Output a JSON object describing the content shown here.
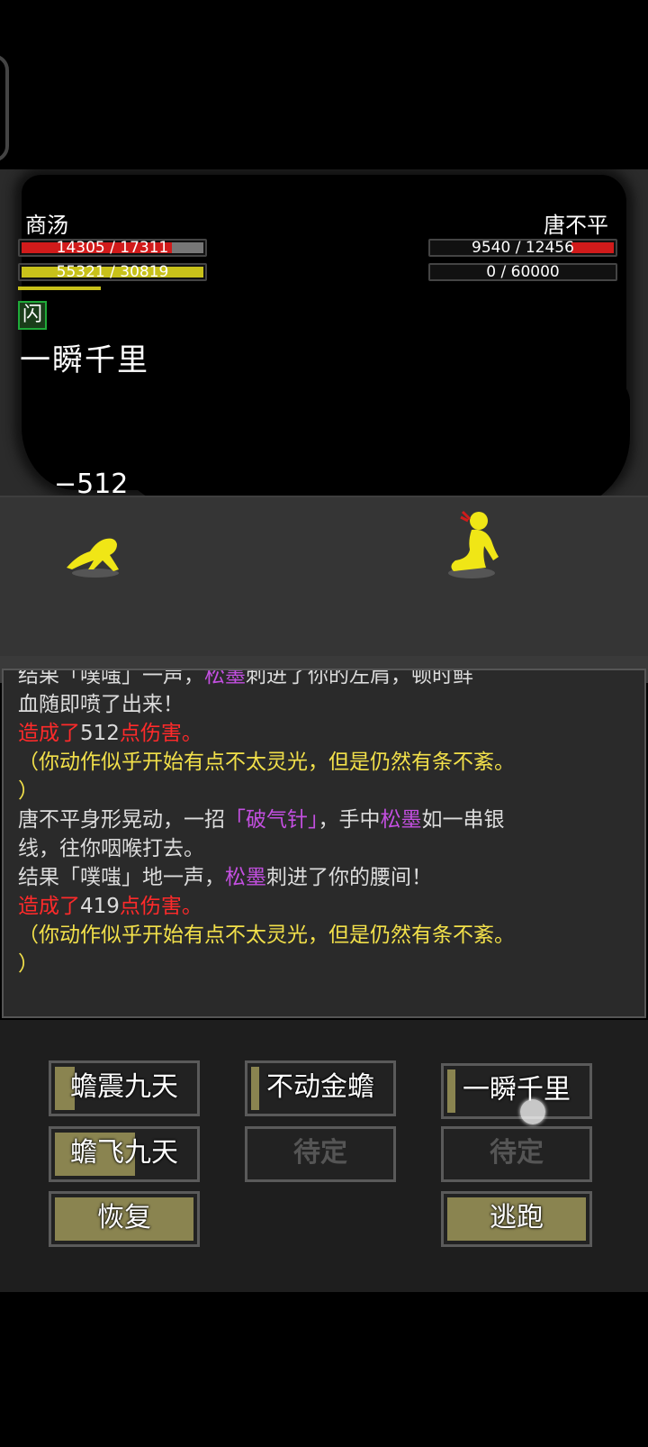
{
  "player": {
    "name": "商汤",
    "hp_text": "14305 / 17311",
    "hp_fraction": 0.826,
    "mp_text": "55321 / 30819",
    "mp_fraction": 1.0,
    "status_badge": "闪",
    "colors": {
      "hp": "#d01b1b",
      "mp": "#c8c11a"
    }
  },
  "enemy": {
    "name": "唐不平",
    "hp_text": "9540 / 12456",
    "hp_fraction": 0.766,
    "mp_text": "0 / 60000",
    "mp_fraction": 0.0
  },
  "battle": {
    "current_skill": "一瞬千里",
    "damage_popup": "−512",
    "figure_color": "#f0e616"
  },
  "log": {
    "lines": [
      {
        "segments": [
          {
            "text": "结果「噗嗤」一声，",
            "c": "l-white"
          },
          {
            "text": "松墨",
            "c": "l-purple"
          },
          {
            "text": "刺进了你的左肩，顿时鲜",
            "c": "l-white"
          }
        ]
      },
      {
        "segments": [
          {
            "text": "血随即喷了出来！",
            "c": "l-white"
          }
        ]
      },
      {
        "segments": [
          {
            "text": "造成了",
            "c": "l-red"
          },
          {
            "text": "512",
            "c": "l-white"
          },
          {
            "text": "点伤害。",
            "c": "l-red"
          }
        ]
      },
      {
        "segments": [
          {
            "text": "（你动作似乎开始有点不太灵光，但是仍然有条不紊。",
            "c": "l-yellow"
          }
        ]
      },
      {
        "segments": [
          {
            "text": "）",
            "c": "l-yellow"
          }
        ]
      },
      {
        "segments": [
          {
            "text": "唐不平身形晃动，一招",
            "c": "l-white"
          },
          {
            "text": "「破气针」",
            "c": "l-purple"
          },
          {
            "text": "，手中",
            "c": "l-white"
          },
          {
            "text": "松墨",
            "c": "l-purple"
          },
          {
            "text": "如一串银",
            "c": "l-white"
          }
        ]
      },
      {
        "segments": [
          {
            "text": "线，往你咽喉打去。",
            "c": "l-white"
          }
        ]
      },
      {
        "segments": [
          {
            "text": "结果「噗嗤」地一声，",
            "c": "l-white"
          },
          {
            "text": "松墨",
            "c": "l-purple"
          },
          {
            "text": "刺进了你的腰间！",
            "c": "l-white"
          }
        ]
      },
      {
        "segments": [
          {
            "text": "造成了",
            "c": "l-red"
          },
          {
            "text": "419",
            "c": "l-white"
          },
          {
            "text": "点伤害。",
            "c": "l-red"
          }
        ]
      },
      {
        "segments": [
          {
            "text": "（你动作似乎开始有点不太灵光，但是仍然有条不紊。",
            "c": "l-yellow"
          }
        ]
      },
      {
        "segments": [
          {
            "text": "）",
            "c": "l-yellow"
          }
        ]
      }
    ]
  },
  "buttons": {
    "skill1": {
      "label": "蟾震九天",
      "fill": 0.14
    },
    "skill2": {
      "label": "不动金蟾",
      "fill": 0.06
    },
    "skill3": {
      "label": "一瞬千里",
      "fill": 0.06
    },
    "skill4": {
      "label": "蟾飞九天",
      "fill": 0.58
    },
    "skill5": {
      "label": "待定"
    },
    "skill6": {
      "label": "待定"
    },
    "recover": {
      "label": "恢复",
      "fill": 1.0
    },
    "escape": {
      "label": "逃跑",
      "fill": 1.0
    }
  }
}
